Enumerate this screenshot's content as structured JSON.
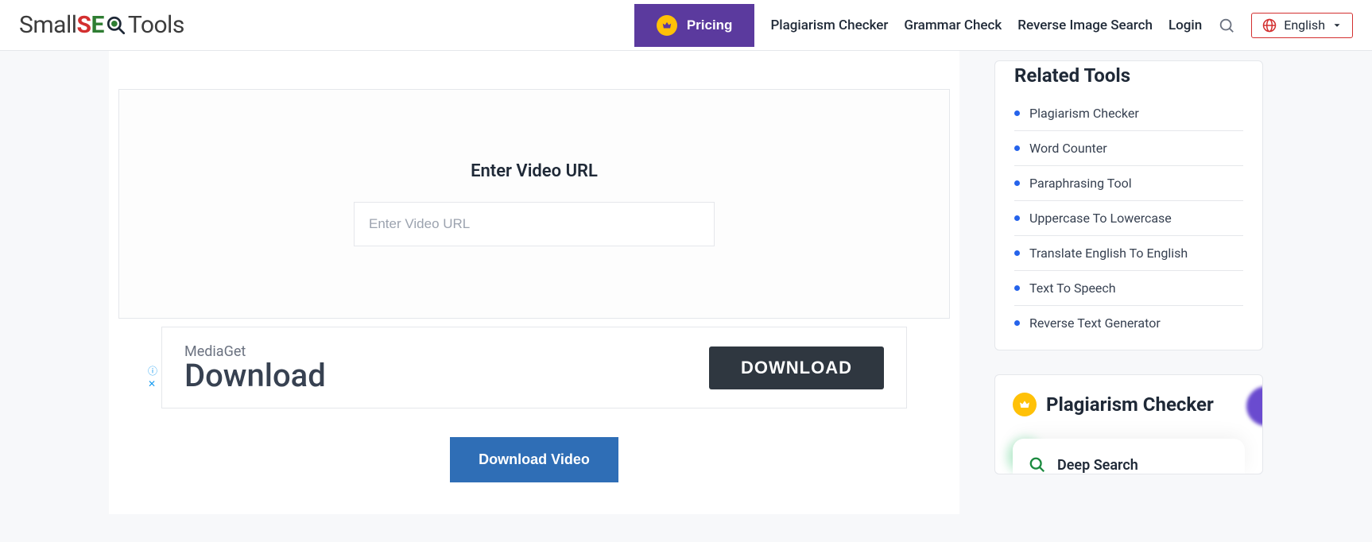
{
  "header": {
    "logo_parts": {
      "p1": "Small",
      "p2": "S",
      "p3": "E",
      "p4": "Tools"
    },
    "pricing": "Pricing",
    "links": [
      "Plagiarism Checker",
      "Grammar Check",
      "Reverse Image Search",
      "Login"
    ],
    "lang": "English"
  },
  "main": {
    "enter_label": "Enter Video URL",
    "placeholder": "Enter Video URL",
    "ad": {
      "brand": "MediaGet",
      "headline": "Download",
      "button": "DOWNLOAD"
    },
    "download_button": "Download Video"
  },
  "sidebar": {
    "related_title": "Related Tools",
    "tools": [
      "Plagiarism Checker",
      "Word Counter",
      "Paraphrasing Tool",
      "Uppercase To Lowercase",
      "Translate English To English",
      "Text To Speech",
      "Reverse Text Generator"
    ],
    "promo": {
      "title": "Plagiarism Checker",
      "feature": "Deep Search"
    }
  }
}
